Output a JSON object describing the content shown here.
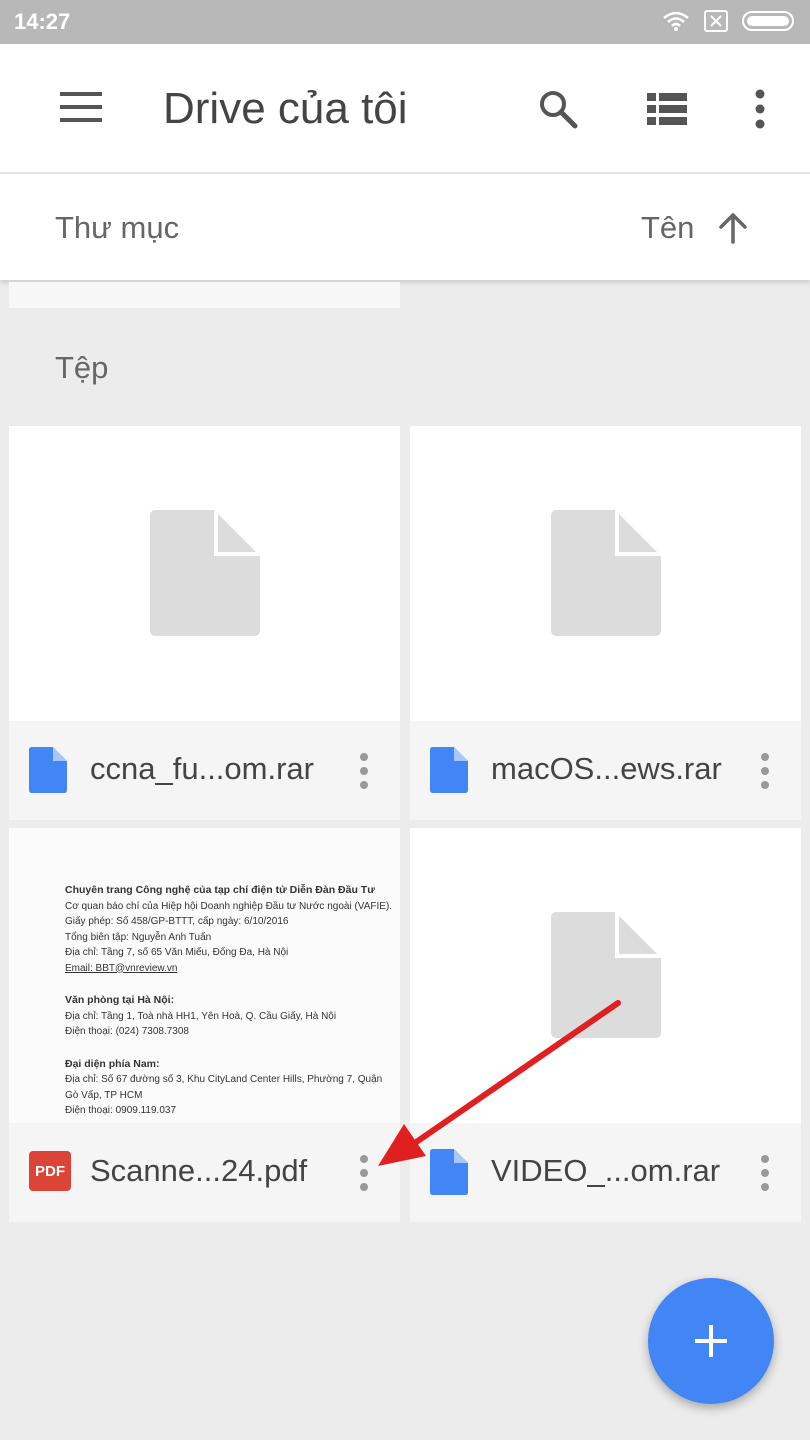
{
  "status_bar": {
    "time": "14:27",
    "icons": [
      "wifi-icon",
      "sim-blocked-icon",
      "battery-icon"
    ]
  },
  "app_bar": {
    "title": "Drive của tôi",
    "menu_icon": "menu-icon",
    "search_icon": "search-icon",
    "view_icon": "list-view-icon",
    "more_icon": "more-vert-icon"
  },
  "sort_bar": {
    "folder_label": "Thư mục",
    "sort_label": "Tên",
    "sort_icon": "arrow-up-icon"
  },
  "files_section": {
    "label": "Tệp"
  },
  "files": [
    {
      "name": "ccna_fu...om.rar",
      "type": "file",
      "icon": "blue-file-icon"
    },
    {
      "name": "macOS...ews.rar",
      "type": "file",
      "icon": "blue-file-icon"
    },
    {
      "name": "Scanne...24.pdf",
      "type": "pdf",
      "icon": "pdf-icon",
      "badge": "PDF",
      "preview": {
        "line1": "Chuyên trang Công nghệ của tạp chí điện tử Diễn Đàn Đầu Tư",
        "line2": "Cơ quan báo chí của Hiệp hội Doanh nghiệp Đầu tư Nước ngoài (VAFIE).",
        "line3": "Giấy phép: Số 458/GP-BTTT, cấp ngày: 6/10/2016",
        "line4": "Tổng biên tập: Nguyễn Anh Tuấn",
        "line5": "Địa chỉ: Tầng 7, số 65 Văn Miếu, Đống Đa, Hà Nội",
        "line6": "Email: BBT@vnreview.vn",
        "line7": "Văn phòng tại Hà Nội:",
        "line8": "Địa chỉ: Tầng 1, Toà nhà HH1, Yên Hoà, Q. Cầu Giấy, Hà Nội",
        "line9": "Điện thoại: (024) 7308.7308",
        "line10": "Đại diện phía Nam:",
        "line11": "Địa chỉ: Số 67 đường số 3, Khu CityLand Center Hills, Phường 7, Quận",
        "line12": "Gò Vấp, TP HCM",
        "line13": "Điện thoại: 0909.119.037"
      }
    },
    {
      "name": "VIDEO_...om.rar",
      "type": "file",
      "icon": "blue-file-icon"
    }
  ],
  "fab": {
    "icon": "plus-icon"
  },
  "colors": {
    "accent": "#4285f4",
    "pdf": "#db4437",
    "arrow": "#e02020"
  }
}
